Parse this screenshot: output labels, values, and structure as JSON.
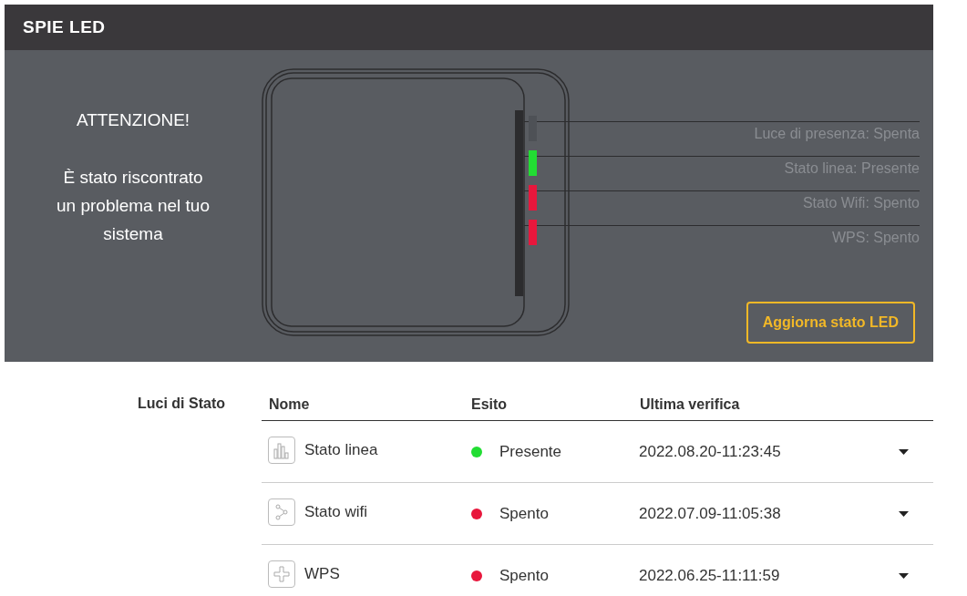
{
  "header": {
    "title": "SPIE LED"
  },
  "alert": {
    "title": "ATTENZIONE!",
    "message": "È stato riscontrato un problema nel tuo sistema"
  },
  "leds": [
    {
      "label": "Luce di presenza: Spenta",
      "on": false
    },
    {
      "label": "Stato linea: Presente",
      "on": true,
      "color": "#22dd33"
    },
    {
      "label": "Stato Wifi: Spento",
      "on": true,
      "color": "#e8173c"
    },
    {
      "label": "WPS: Spento",
      "on": true,
      "color": "#e8173c"
    }
  ],
  "refresh_button": "Aggiorna stato LED",
  "section_label": "Luci di Stato",
  "table": {
    "columns": [
      "Nome",
      "Esito",
      "Ultima verifica"
    ],
    "rows": [
      {
        "kind": "line",
        "name": "Stato linea",
        "status": "Presente",
        "color": "#22dd33",
        "checked_at": "2022.08.20-11:23:45",
        "expanded": false
      },
      {
        "kind": "wifi",
        "name": "Stato wifi",
        "status": "Spento",
        "color": "#e8173c",
        "checked_at": "2022.07.09-11:05:38",
        "expanded": false
      },
      {
        "kind": "wps",
        "name": "WPS",
        "status": "Spento",
        "color": "#e8173c",
        "checked_at": "2022.06.25-11:11:59",
        "expanded": false
      }
    ]
  }
}
